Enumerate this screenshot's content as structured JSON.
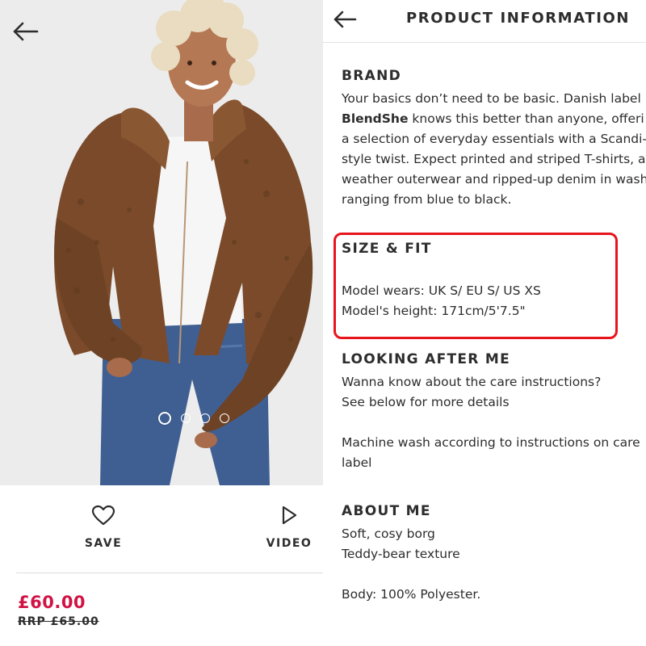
{
  "product": {
    "save_label": "SAVE",
    "video_label": "VIDEO",
    "price": "£60.00",
    "rrp": "RRP £65.00",
    "gallery": {
      "total_images": 4,
      "active_index": 0
    }
  },
  "info_panel": {
    "title": "PRODUCT INFORMATION",
    "brand": {
      "heading": "BRAND",
      "line1": "Your basics don’t need to be basic. Danish label",
      "brand_name": "BlendShe",
      "line2_rest": " knows this better than anyone, offeri",
      "line3": "a selection of everyday essentials with a Scandi-",
      "line4": "style twist. Expect printed and striped T-shirts, all-",
      "line5": "weather outerwear and ripped-up denim in wash",
      "line6": "ranging from blue to black."
    },
    "size_fit": {
      "heading": "SIZE & FIT",
      "model_wears": "Model wears: UK S/ EU S/ US XS",
      "model_height": "Model's height: 171cm/5'7.5\""
    },
    "care": {
      "heading": "LOOKING AFTER ME",
      "line1": "Wanna know about the care instructions?",
      "line2": "See below for more details",
      "line3": "Machine wash according to instructions on care",
      "line4": "label"
    },
    "about": {
      "heading": "ABOUT ME",
      "line1": "Soft, cosy borg",
      "line2": "Teddy-bear texture",
      "line3": "Body: 100% Polyester."
    }
  },
  "colors": {
    "price": "#d01345",
    "highlight_box": "#e8141c",
    "text": "#2d2d2d",
    "jacket": "#7a4a2a"
  },
  "icons": [
    "back-arrow-icon",
    "heart-icon",
    "play-icon"
  ]
}
